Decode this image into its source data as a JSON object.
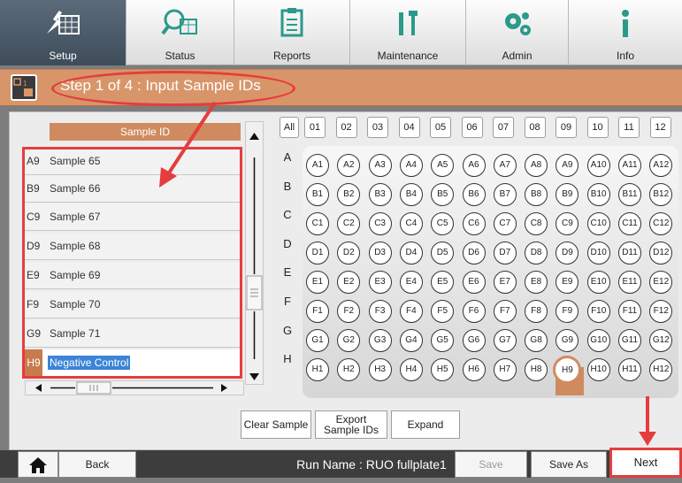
{
  "toolbar": {
    "tabs": [
      {
        "label": "Setup",
        "icon": "setup-icon"
      },
      {
        "label": "Status",
        "icon": "status-icon"
      },
      {
        "label": "Reports",
        "icon": "reports-icon"
      },
      {
        "label": "Maintenance",
        "icon": "maintenance-icon"
      },
      {
        "label": "Admin",
        "icon": "admin-icon"
      },
      {
        "label": "Info",
        "icon": "info-icon"
      }
    ],
    "active": "Setup"
  },
  "step": {
    "title": "Step 1 of 4 : Input Sample IDs"
  },
  "sample_list": {
    "header": "Sample ID",
    "rows": [
      {
        "well": "A9",
        "name": "Sample 65"
      },
      {
        "well": "B9",
        "name": "Sample 66"
      },
      {
        "well": "C9",
        "name": "Sample 67"
      },
      {
        "well": "D9",
        "name": "Sample 68"
      },
      {
        "well": "E9",
        "name": "Sample 69"
      },
      {
        "well": "F9",
        "name": "Sample 70"
      },
      {
        "well": "G9",
        "name": "Sample 71"
      },
      {
        "well": "H9",
        "name": "Negative Control"
      }
    ],
    "selected_well": "H9"
  },
  "plate": {
    "all_label": "All",
    "columns": [
      "01",
      "02",
      "03",
      "04",
      "05",
      "06",
      "07",
      "08",
      "09",
      "10",
      "11",
      "12"
    ],
    "rows": [
      "A",
      "B",
      "C",
      "D",
      "E",
      "F",
      "G",
      "H"
    ],
    "selected_well": "H9"
  },
  "actions": {
    "clear": "Clear Sample",
    "export_line1": "Export",
    "export_line2": "Sample IDs",
    "expand": "Expand"
  },
  "footer": {
    "back": "Back",
    "run_name": "Run Name : RUO fullplate1",
    "save": "Save",
    "save_as": "Save As",
    "next": "Next"
  },
  "colors": {
    "accent": "#d08a60",
    "annotation": "#e53d3d",
    "selection": "#3b84d6"
  }
}
